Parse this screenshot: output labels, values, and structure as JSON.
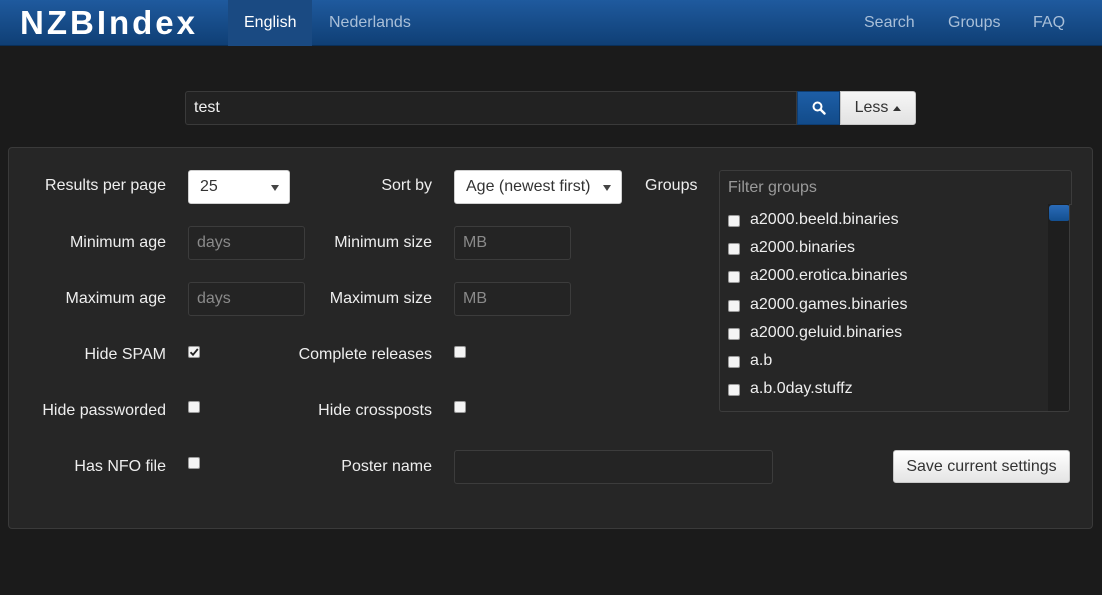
{
  "nav": {
    "brand": "NZBIndex",
    "languages": [
      {
        "label": "English",
        "active": true
      },
      {
        "label": "Nederlands",
        "active": false
      }
    ],
    "links": [
      "Search",
      "Groups",
      "FAQ"
    ]
  },
  "search": {
    "value": "test",
    "toggle_label": "Less"
  },
  "form": {
    "results_per_page": {
      "label": "Results per page",
      "value": "25"
    },
    "sort_by": {
      "label": "Sort by",
      "value": "Age (newest first)"
    },
    "min_age": {
      "label": "Minimum age",
      "placeholder": "days"
    },
    "max_age": {
      "label": "Maximum age",
      "placeholder": "days"
    },
    "min_size": {
      "label": "Minimum size",
      "placeholder": "MB"
    },
    "max_size": {
      "label": "Maximum size",
      "placeholder": "MB"
    },
    "hide_spam": {
      "label": "Hide SPAM",
      "checked": true
    },
    "complete_releases": {
      "label": "Complete releases",
      "checked": false
    },
    "hide_passworded": {
      "label": "Hide passworded",
      "checked": false
    },
    "hide_crossposts": {
      "label": "Hide crossposts",
      "checked": false
    },
    "has_nfo": {
      "label": "Has NFO file",
      "checked": false
    },
    "poster_name": {
      "label": "Poster name",
      "value": ""
    },
    "save_label": "Save current settings"
  },
  "groups": {
    "label": "Groups",
    "filter_placeholder": "Filter groups",
    "items": [
      "a2000.beeld.binaries",
      "a2000.binaries",
      "a2000.erotica.binaries",
      "a2000.games.binaries",
      "a2000.geluid.binaries",
      "a.b",
      "a.b.0day.stuffz"
    ]
  },
  "colors": {
    "navbar": "#1f5a9e",
    "background": "#1b1b1b",
    "panel": "#262626",
    "accent": "#1d5ea6"
  }
}
